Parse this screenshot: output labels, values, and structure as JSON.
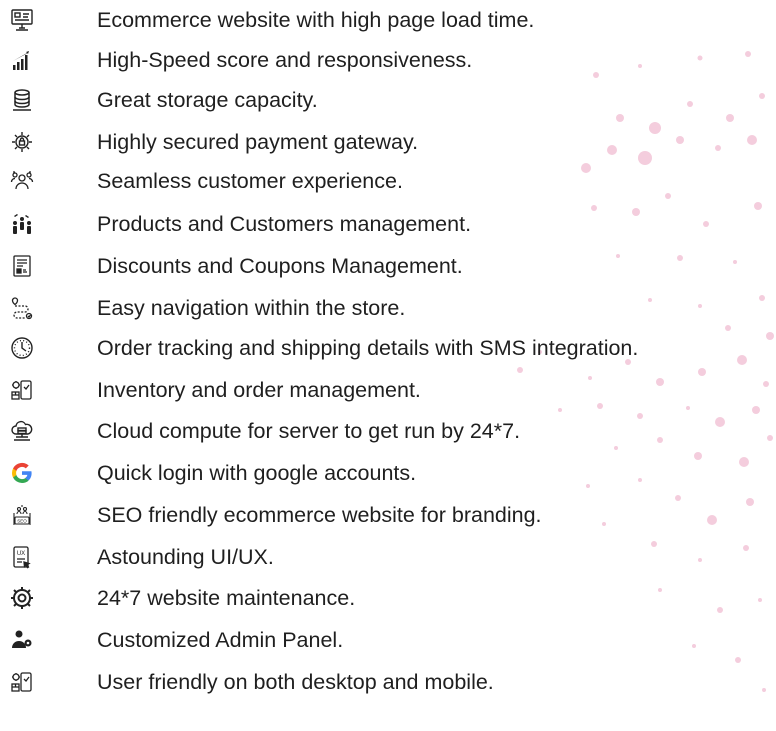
{
  "features": [
    {
      "icon": "website-speed-icon",
      "text": "Ecommerce website with high page load time."
    },
    {
      "icon": "bar-chart-icon",
      "text": "High-Speed score and responsiveness."
    },
    {
      "icon": "database-icon",
      "text": "Great storage capacity."
    },
    {
      "icon": "secure-payment-icon",
      "text": "Highly secured payment gateway."
    },
    {
      "icon": "customer-group-icon",
      "text": "Seamless customer experience."
    },
    {
      "icon": "people-management-icon",
      "text": "Products and Customers management."
    },
    {
      "icon": "coupon-document-icon",
      "text": "Discounts and Coupons Management."
    },
    {
      "icon": "navigation-route-icon",
      "text": "Easy navigation within the store."
    },
    {
      "icon": "clock-icon",
      "text": "Order tracking and shipping details with SMS integration."
    },
    {
      "icon": "inventory-icon",
      "text": "Inventory and order management."
    },
    {
      "icon": "cloud-server-icon",
      "text": "Cloud compute for server to get run by 24*7."
    },
    {
      "icon": "google-icon",
      "text": "Quick login with google accounts."
    },
    {
      "icon": "seo-icon",
      "text": "SEO friendly ecommerce website for branding."
    },
    {
      "icon": "ux-ui-icon",
      "text": "Astounding UI/UX."
    },
    {
      "icon": "support-maintenance-icon",
      "text": "24*7 website maintenance."
    },
    {
      "icon": "admin-panel-icon",
      "text": "Customized Admin Panel."
    },
    {
      "icon": "responsive-devices-icon",
      "text": "User friendly on both desktop and mobile."
    }
  ],
  "colors": {
    "text": "#1f1f1f",
    "icon": "#222222",
    "dots": "#f4cddd",
    "google_blue": "#4285F4",
    "google_red": "#EA4335",
    "google_yellow": "#FBBC05",
    "google_green": "#34A853"
  }
}
